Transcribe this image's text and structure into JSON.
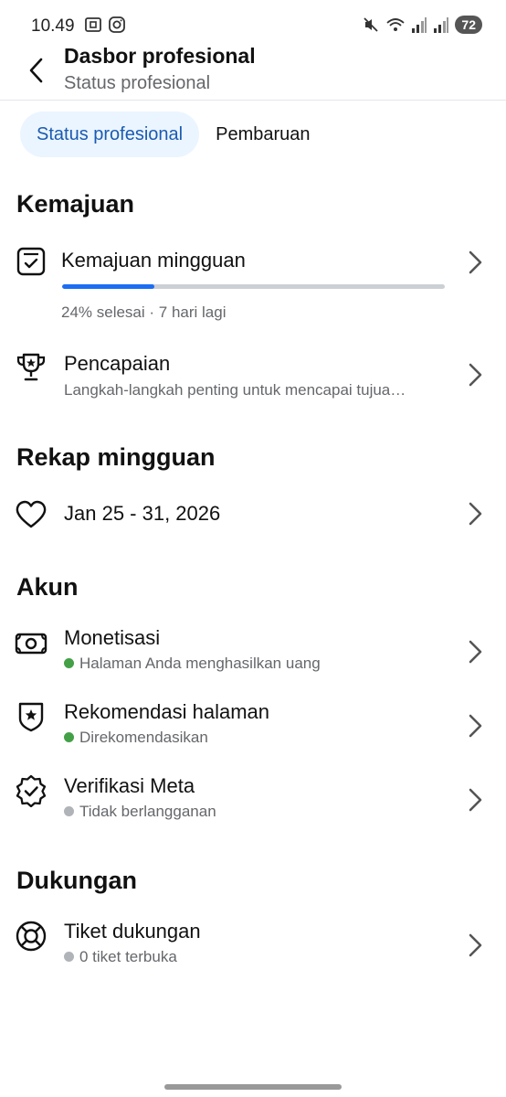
{
  "status_bar": {
    "time": "10.49",
    "battery": "72"
  },
  "header": {
    "title": "Dasbor profesional",
    "subtitle": "Status profesional"
  },
  "tabs": [
    {
      "label": "Status profesional",
      "active": true
    },
    {
      "label": "Pembaruan",
      "active": false
    }
  ],
  "sections": {
    "kemajuan": {
      "title": "Kemajuan",
      "weekly_progress": {
        "title": "Kemajuan mingguan",
        "progress": 0.24,
        "meta": "24% selesai · 7 hari lagi"
      },
      "achievements": {
        "title": "Pencapaian",
        "subtitle": "Langkah-langkah penting untuk mencapai tujua…"
      }
    },
    "rekap": {
      "title": "Rekap mingguan",
      "range": "Jan 25 - 31, 2026"
    },
    "akun": {
      "title": "Akun",
      "items": [
        {
          "title": "Monetisasi",
          "status": "Halaman Anda menghasilkan uang",
          "status_color": "#44a047"
        },
        {
          "title": "Rekomendasi halaman",
          "status": "Direkomendasikan",
          "status_color": "#44a047"
        },
        {
          "title": "Verifikasi Meta",
          "status": "Tidak berlangganan",
          "status_color": "#b0b3b8"
        }
      ]
    },
    "dukungan": {
      "title": "Dukungan",
      "items": [
        {
          "title": "Tiket dukungan",
          "status": "0 tiket terbuka",
          "status_color": "#b0b3b8"
        }
      ]
    }
  },
  "icons": {
    "back": "arrow-left-icon",
    "weekly_progress": "checklist-icon",
    "achievements": "trophy-icon",
    "rekap": "heart-icon",
    "monetisasi": "money-icon",
    "rekomendasi": "shield-star-icon",
    "verifikasi": "verified-badge-icon",
    "tiket": "lifebuoy-icon",
    "chevron": "chevron-right-icon"
  },
  "colors": {
    "accent": "#1b6ef3",
    "tab_active_bg": "#ebf5ff",
    "tab_active_text": "#1b5bb0"
  }
}
